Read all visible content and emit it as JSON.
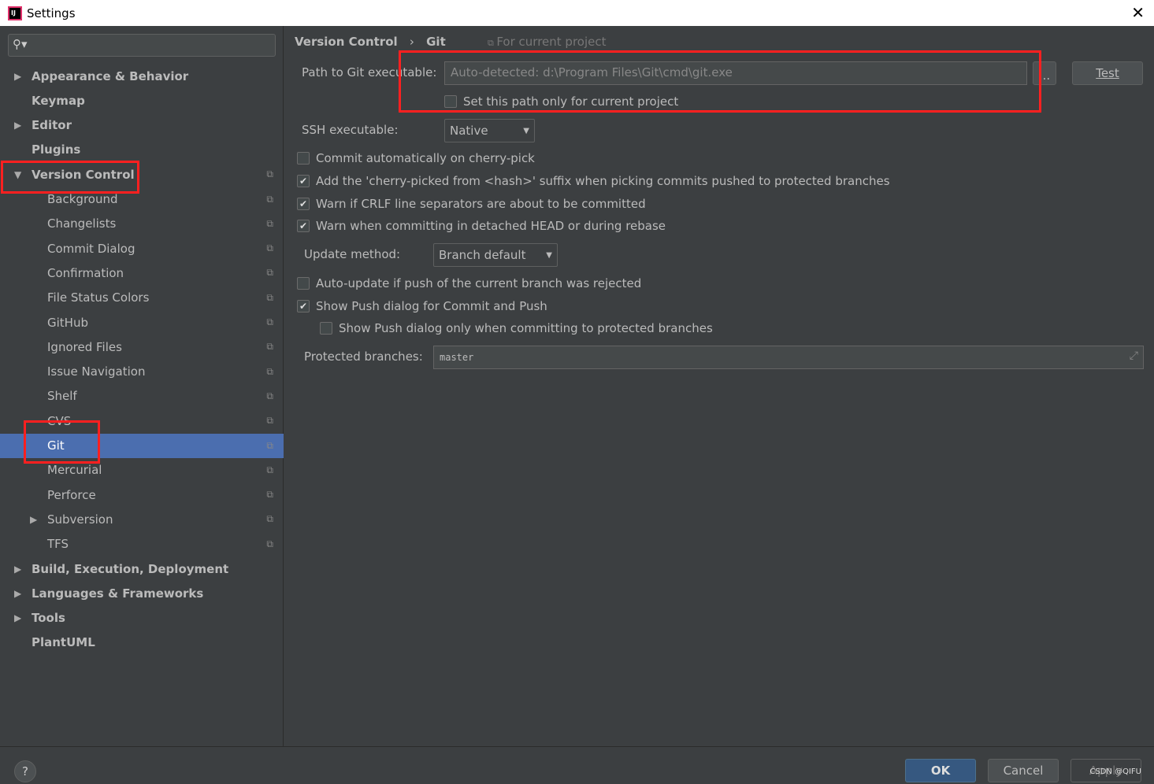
{
  "window": {
    "title": "Settings"
  },
  "sidebar": {
    "search_placeholder": "",
    "items": [
      {
        "label": "Appearance & Behavior",
        "level": 0,
        "arrow": "▶",
        "proj": false
      },
      {
        "label": "Keymap",
        "level": 0,
        "arrow": "",
        "proj": false
      },
      {
        "label": "Editor",
        "level": 0,
        "arrow": "▶",
        "proj": false
      },
      {
        "label": "Plugins",
        "level": 0,
        "arrow": "",
        "proj": false
      },
      {
        "label": "Version Control",
        "level": 0,
        "arrow": "▼",
        "proj": true
      },
      {
        "label": "Background",
        "level": 1,
        "arrow": "",
        "proj": true
      },
      {
        "label": "Changelists",
        "level": 1,
        "arrow": "",
        "proj": true
      },
      {
        "label": "Commit Dialog",
        "level": 1,
        "arrow": "",
        "proj": true
      },
      {
        "label": "Confirmation",
        "level": 1,
        "arrow": "",
        "proj": true
      },
      {
        "label": "File Status Colors",
        "level": 1,
        "arrow": "",
        "proj": true
      },
      {
        "label": "GitHub",
        "level": 1,
        "arrow": "",
        "proj": true
      },
      {
        "label": "Ignored Files",
        "level": 1,
        "arrow": "",
        "proj": true
      },
      {
        "label": "Issue Navigation",
        "level": 1,
        "arrow": "",
        "proj": true
      },
      {
        "label": "Shelf",
        "level": 1,
        "arrow": "",
        "proj": true
      },
      {
        "label": "CVS",
        "level": 1,
        "arrow": "",
        "proj": true
      },
      {
        "label": "Git",
        "level": 1,
        "arrow": "",
        "proj": true,
        "selected": true
      },
      {
        "label": "Mercurial",
        "level": 1,
        "arrow": "",
        "proj": true
      },
      {
        "label": "Perforce",
        "level": 1,
        "arrow": "",
        "proj": true
      },
      {
        "label": "Subversion",
        "level": 1,
        "arrow": "▶",
        "proj": true
      },
      {
        "label": "TFS",
        "level": 1,
        "arrow": "",
        "proj": true
      },
      {
        "label": "Build, Execution, Deployment",
        "level": 0,
        "arrow": "▶",
        "proj": false
      },
      {
        "label": "Languages & Frameworks",
        "level": 0,
        "arrow": "▶",
        "proj": false
      },
      {
        "label": "Tools",
        "level": 0,
        "arrow": "▶",
        "proj": false
      },
      {
        "label": "PlantUML",
        "level": 0,
        "arrow": "",
        "proj": false
      }
    ]
  },
  "breadcrumb": {
    "parent": "Version Control",
    "sep": "›",
    "current": "Git",
    "scope": "For current project"
  },
  "git": {
    "path_label": "Path to Git executable:",
    "path_value": "Auto-detected: d:\\Program Files\\Git\\cmd\\git.exe",
    "browse": "...",
    "test": "Test",
    "path_only_project": {
      "label": "Set this path only for current project",
      "checked": false
    },
    "ssh_label": "SSH executable:",
    "ssh_value": "Native",
    "options": [
      {
        "label": "Commit automatically on cherry-pick",
        "checked": false
      },
      {
        "label": "Add the 'cherry-picked from <hash>' suffix when picking commits pushed to protected branches",
        "checked": true
      },
      {
        "label": "Warn if CRLF line separators are about to be committed",
        "checked": true
      },
      {
        "label": "Warn when committing in detached HEAD or during rebase",
        "checked": true
      }
    ],
    "update_label": "Update method:",
    "update_value": "Branch default",
    "options2": [
      {
        "label": "Auto-update if push of the current branch was rejected",
        "checked": false
      },
      {
        "label": "Show Push dialog for Commit and Push",
        "checked": true
      },
      {
        "label": "Show Push dialog only when committing to protected branches",
        "checked": false
      }
    ],
    "protected_label": "Protected branches:",
    "protected_value": "master"
  },
  "footer": {
    "help": "?",
    "ok": "OK",
    "cancel": "Cancel",
    "apply": "Apply",
    "watermark": "CSDN @QIFU"
  },
  "colors": {
    "selection": "#4b6eaf",
    "highlight": "#ff2020",
    "ok": "#365880"
  }
}
